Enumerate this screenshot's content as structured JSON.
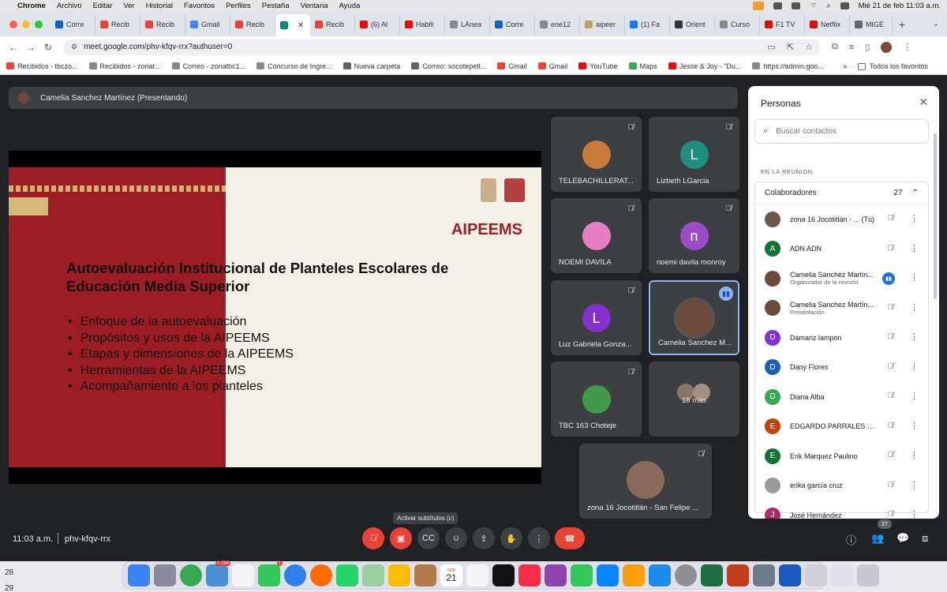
{
  "menubar": {
    "app": "Chrome",
    "menus": [
      "Archivo",
      "Editar",
      "Ver",
      "Historial",
      "Favoritos",
      "Perfiles",
      "Pestaña",
      "Ventana",
      "Ayuda"
    ],
    "datetime": "Mié 21 de feb  11:03 a.m."
  },
  "tabs": [
    {
      "label": "Corre",
      "color": "#0a66c2"
    },
    {
      "label": "Recib",
      "color": "#ea4335"
    },
    {
      "label": "Recib",
      "color": "#ea4335"
    },
    {
      "label": "Gmail",
      "color": "#4285f4"
    },
    {
      "label": "Recib",
      "color": "#ea4335"
    },
    {
      "label": "",
      "color": "#00897b",
      "active": true
    },
    {
      "label": "Recib",
      "color": "#ea4335"
    },
    {
      "label": "(6) Al",
      "color": "#ff0000"
    },
    {
      "label": "Habili",
      "color": "#ff0000"
    },
    {
      "label": "LÁnea",
      "color": "#888888"
    },
    {
      "label": "Corre",
      "color": "#0a66c2"
    },
    {
      "label": "ene12",
      "color": "#888888"
    },
    {
      "label": "aipeer",
      "color": "#c49a6c"
    },
    {
      "label": "(1) Fa",
      "color": "#1877f2"
    },
    {
      "label": "Orient",
      "color": "#333333"
    },
    {
      "label": "Curso",
      "color": "#888888"
    },
    {
      "label": "F1 TV",
      "color": "#e10600"
    },
    {
      "label": "Netflix",
      "color": "#e50914"
    },
    {
      "label": "MIGE",
      "color": "#666666"
    }
  ],
  "address": {
    "url": "meet.google.com/phv-kfqv-rrx?authuser=0"
  },
  "bookmarks": [
    {
      "label": "Recibidos - tbczo...",
      "color": "#ea4335"
    },
    {
      "label": "Recibidos - zonat...",
      "color": "#888888"
    },
    {
      "label": "Correo - zonatbc1...",
      "color": "#888888"
    },
    {
      "label": "Concurso de Ingre...",
      "color": "#888888"
    },
    {
      "label": "Nueva carpeta",
      "color": "#5f6368"
    },
    {
      "label": "Correo: xocotepetl...",
      "color": "#5f6368"
    },
    {
      "label": "Gmail",
      "color": "#ea4335"
    },
    {
      "label": "Gmail",
      "color": "#ea4335"
    },
    {
      "label": "YouTube",
      "color": "#ff0000"
    },
    {
      "label": "Maps",
      "color": "#34a853"
    },
    {
      "label": "Jesse & Joy - \"Du...",
      "color": "#ff0000"
    },
    {
      "label": "https://admin.goo...",
      "color": "#888888"
    }
  ],
  "bookmarks_all": "Todos los favoritos",
  "meeting": {
    "presenter_label": "Camelia Sanchez Martínez (Presentando)",
    "time": "11:03 a.m.",
    "code": "phv-kfqv-rrx",
    "tooltip": "Activar subtítulos (c)",
    "people_count": "27"
  },
  "slide": {
    "brand": "AIPEEMS",
    "title": "Autoevaluación Institucional de Planteles Escolares de Educación Media Superior",
    "bullets": [
      "Enfoque de la autoevaluación",
      "Propósitos y usos de la AIPEEMS",
      "Etapas y dimensiones de la AIPEEMS",
      "Herramientas de la AIPEEMS",
      "Acompañamiento a los planteles"
    ]
  },
  "tiles": [
    {
      "name": "TELEBACHILLERAT...",
      "initial": "",
      "color": "#c97b3b"
    },
    {
      "name": "Lizbeth LGarcia",
      "initial": "L",
      "color": "#1e8e7e"
    },
    {
      "name": "NOEMI DAVILA",
      "initial": "",
      "color": "#e87fc4"
    },
    {
      "name": "noemi davila monroy",
      "initial": "n",
      "color": "#9c4cc7"
    },
    {
      "name": "Luz Gabriela Gonza...",
      "initial": "L",
      "color": "#8430ce"
    },
    {
      "name": "Camelia Sanchez M...",
      "initial": "",
      "color": "#6b4a3a"
    },
    {
      "name": "TBC 163 Choteje",
      "initial": "",
      "color": "#3f9a4a"
    },
    {
      "name": "18 más",
      "initial": "",
      "color": "#888888"
    },
    {
      "name": "zona 16 Jocotitlán - San Felipe ...",
      "initial": "",
      "color": "#8a6a5a"
    }
  ],
  "panel": {
    "title": "Personas",
    "search_placeholder": "Buscar contactos",
    "section": "EN LA REUNIÓN",
    "group_label": "Colaboradores",
    "group_count": "27",
    "people": [
      {
        "name": "zona 16 Jocotitlán - ... (Tú)",
        "role": "",
        "initial": "",
        "color": "#6b5a4a"
      },
      {
        "name": "ADN ADN",
        "role": "",
        "initial": "A",
        "color": "#137333"
      },
      {
        "name": "Camelia Sanchez Martín...",
        "role": "Organizador de la reunión",
        "initial": "",
        "color": "#6b4a3a",
        "speaking": true
      },
      {
        "name": "Camelia Sanchez Martín...",
        "role": "Presentación",
        "initial": "",
        "color": "#6b4a3a"
      },
      {
        "name": "Damariz lampon",
        "role": "",
        "initial": "D",
        "color": "#8430ce"
      },
      {
        "name": "Dany Flores",
        "role": "",
        "initial": "D",
        "color": "#1a5fb4"
      },
      {
        "name": "Diana Alba",
        "role": "",
        "initial": "D",
        "color": "#34a853"
      },
      {
        "name": "EDGARDO PARRALES C...",
        "role": "",
        "initial": "E",
        "color": "#c2410c"
      },
      {
        "name": "Erik Marquez Paulino",
        "role": "",
        "initial": "E",
        "color": "#137333"
      },
      {
        "name": "erika garcía cruz",
        "role": "",
        "initial": "",
        "color": "#9a9a9a"
      },
      {
        "name": "José Hernández",
        "role": "",
        "initial": "J",
        "color": "#b0286a"
      }
    ]
  },
  "dock": {
    "side_numbers": [
      "28",
      "29"
    ],
    "mail_badge": "4.296",
    "facetime_badge": "1",
    "cal_month": "FEB",
    "cal_day": "21"
  }
}
